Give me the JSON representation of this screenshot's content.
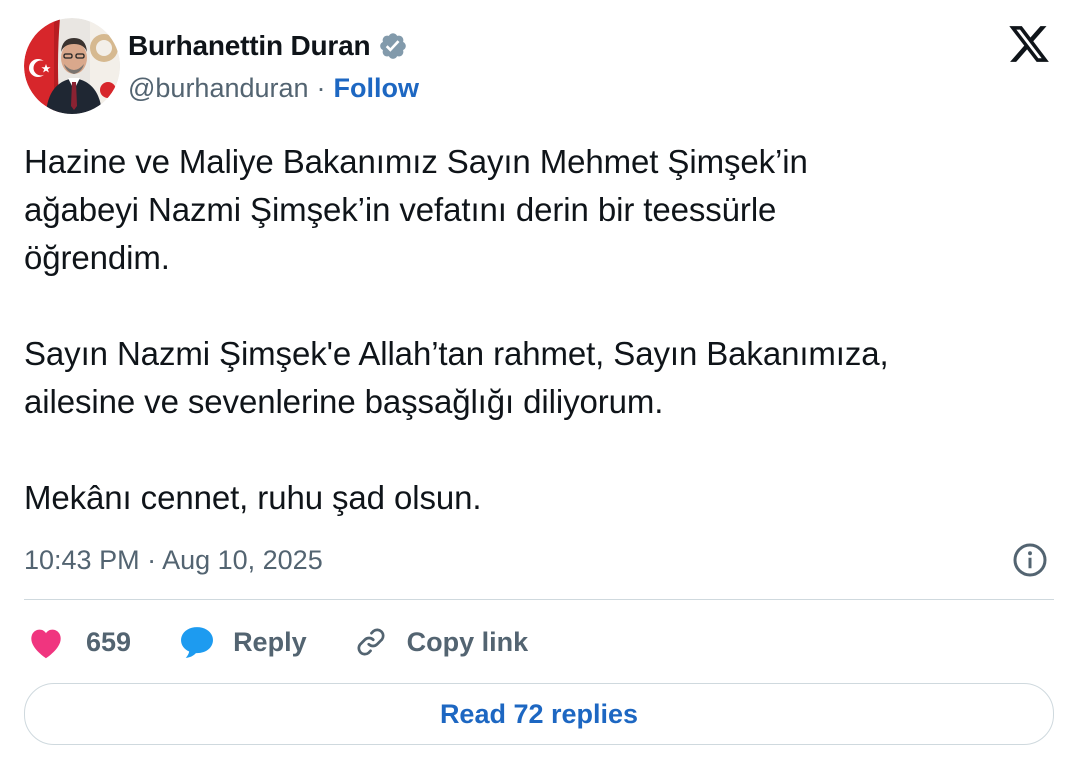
{
  "author": {
    "display_name": "Burhanettin Duran",
    "handle": "@burhanduran",
    "separator": "·",
    "follow_label": "Follow",
    "verified": true
  },
  "tweet": {
    "paragraphs": [
      [
        "Hazine ve Maliye Bakanımız Sayın Mehmet Şimşek’in",
        "ağabeyi Nazmi Şimşek’in vefatını derin bir teessürle",
        "öğrendim."
      ],
      [
        "Sayın Nazmi Şimşek'e Allah’tan rahmet, Sayın Bakanımıza,",
        "ailesine ve sevenlerine başsağlığı diliyorum."
      ],
      [
        "Mekânı cennet, ruhu şad olsun."
      ]
    ]
  },
  "meta": {
    "timestamp": "10:43 PM · Aug 10, 2025"
  },
  "actions": {
    "like_count": "659",
    "reply_label": "Reply",
    "copy_link_label": "Copy link"
  },
  "footer": {
    "read_replies_label": "Read 72 replies"
  },
  "colors": {
    "text": "#0f1419",
    "secondary": "#536471",
    "link": "#1d67c2",
    "like": "#f0357f",
    "reply_icon": "#1d9bf0",
    "border": "#cfd9de"
  },
  "icons": {
    "brand": "x-logo-icon",
    "verified": "verified-badge-icon",
    "info": "info-icon",
    "like": "heart-icon",
    "reply": "speech-bubble-icon",
    "copy": "link-icon"
  }
}
